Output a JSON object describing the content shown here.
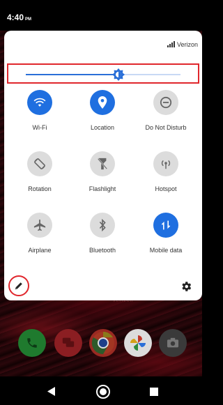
{
  "status": {
    "time": "4:40",
    "ampm": "PM"
  },
  "carrier": "Verizon",
  "brightness": {
    "level": 0.6
  },
  "tiles": [
    {
      "label": "Wi-Fi",
      "icon": "wifi-icon",
      "state": "on"
    },
    {
      "label": "Location",
      "icon": "location-icon",
      "state": "on"
    },
    {
      "label": "Do Not Disturb",
      "icon": "do-not-disturb-icon",
      "state": "off"
    },
    {
      "label": "Rotation",
      "icon": "rotation-icon",
      "state": "off"
    },
    {
      "label": "Flashlight",
      "icon": "flashlight-icon",
      "state": "off"
    },
    {
      "label": "Hotspot",
      "icon": "hotspot-icon",
      "state": "off"
    },
    {
      "label": "Airplane",
      "icon": "airplane-icon",
      "state": "off"
    },
    {
      "label": "Bluetooth",
      "icon": "bluetooth-icon",
      "state": "off"
    },
    {
      "label": "Mobile data",
      "icon": "mobile-data-icon",
      "state": "on"
    }
  ],
  "home_label": "verizon",
  "dock": [
    "phone-icon",
    "messages-icon",
    "chrome-icon",
    "photos-icon",
    "camera-icon"
  ],
  "colors": {
    "accent": "#1f6fe0",
    "highlight": "#e0262c",
    "tile_off": "#dcdcdc"
  }
}
